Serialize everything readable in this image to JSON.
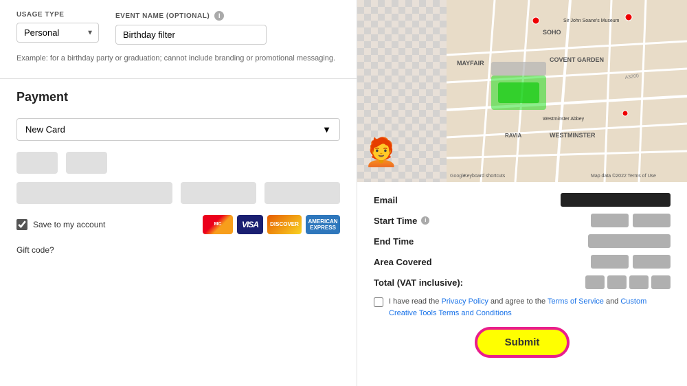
{
  "left": {
    "usage_type_label": "USAGE TYPE",
    "event_name_label": "EVENT NAME (OPTIONAL)",
    "usage_type_value": "Personal",
    "event_name_value": "Birthday filter",
    "helper_text": "Example: for a birthday party or graduation; cannot include branding or promotional messaging.",
    "payment_title": "Payment",
    "new_card_label": "New Card",
    "save_label": "Save to my account",
    "gift_code_label": "Gift code?",
    "card_logos": [
      "MasterCard",
      "VISA",
      "DISCOVER",
      "AMEX"
    ]
  },
  "right": {
    "email_label": "Email",
    "start_time_label": "Start Time",
    "end_time_label": "End Time",
    "area_covered_label": "Area Covered",
    "total_label": "Total (VAT inclusive):",
    "tos_text_before": "I have read the ",
    "privacy_policy": "Privacy Policy",
    "tos_mid": " and agree to the ",
    "terms_of_service": "Terms of Service",
    "tos_and": " and ",
    "custom_terms": "Custom Creative Tools Terms and Conditions",
    "submit_label": "Submit",
    "map_labels": [
      "SOHO",
      "MAYFAIR",
      "COVENT GARDEN",
      "WESTMINSTER",
      "RAVIA"
    ],
    "keyboard_shortcuts": "Keyboard shortcuts",
    "map_data": "Map data ©2022",
    "terms_of_use": "Terms of Use"
  },
  "icons": {
    "info": "i",
    "chevron_down": "▼",
    "checkbox_checked": "✓"
  }
}
